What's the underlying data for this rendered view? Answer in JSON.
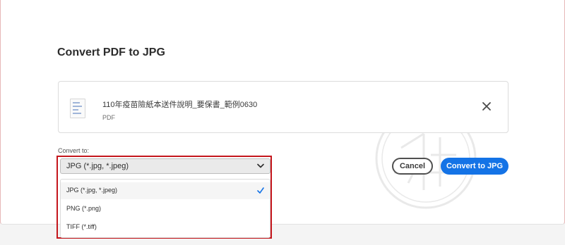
{
  "dialog": {
    "title": "Convert PDF to JPG"
  },
  "file": {
    "name": "110年疫苗險紙本送件說明_要保書_範例0630",
    "type": "PDF"
  },
  "convert": {
    "label": "Convert to:",
    "selected": "JPG (*.jpg, *.jpeg)",
    "options": [
      {
        "label": "JPG (*.jpg, *.jpeg)",
        "checked": true
      },
      {
        "label": "PNG (*.png)",
        "checked": false
      },
      {
        "label": "TIFF (*.tiff)",
        "checked": false
      }
    ]
  },
  "actions": {
    "cancel": "Cancel",
    "primary": "Convert to JPG"
  },
  "colors": {
    "primary": "#1473e6",
    "highlight": "#c4161c"
  },
  "icons": {
    "file": "pdf-file-icon",
    "close": "close-icon",
    "chevron": "chevron-down-icon",
    "check": "checkmark-icon"
  }
}
